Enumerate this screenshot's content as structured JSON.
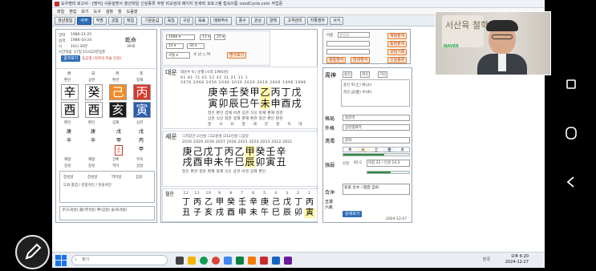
{
  "app": {
    "icon_color": "#c62d2d"
  },
  "window": {
    "title": "도우명리 보고서 - [명식]",
    "title_parts": [
      "사용설명서",
      "출산택일",
      "신살종류",
      "주방 비교검색",
      "페이지 만세력",
      "포토그램 접속이름",
      "coodCycle.com",
      "작업중"
    ]
  },
  "menu": [
    "파일",
    "편집",
    "보기",
    "도구",
    "설정",
    "창",
    "도움말"
  ],
  "toolbar": [
    "생년월일",
    "사주",
    "작명",
    "궁합",
    "택일",
    "기문둔갑",
    "육임",
    "구성",
    "육효",
    "매화역수",
    "풍수",
    "관상",
    "양택",
    "고객관리",
    "카톡명부",
    "서식"
  ],
  "left": {
    "birth_label": "양력",
    "birth_date": "1986-11-25",
    "lunar_label": "음력",
    "lunar_date": "1986-10-24",
    "time_label": "시",
    "time": "10시 30분",
    "apply_label": "시간적용",
    "apply_val": "17일 15시22분입춘",
    "gender": "乾命",
    "age": "39세",
    "btn_blue": "결과보기",
    "note": "동공생 (귀하의 미술 신살)",
    "header": [
      "時",
      "日",
      "月",
      "年"
    ],
    "ten_gods_top": [
      "편인",
      "상관",
      "편관",
      "정재"
    ],
    "stems": [
      "辛",
      "癸",
      "己",
      "丙"
    ],
    "branches": [
      "酉",
      "酉",
      "亥",
      "寅"
    ],
    "ten_gods_bot": [
      "편인",
      "편인",
      "겁재",
      "상관"
    ],
    "hidden": [
      [
        "庚",
        "辛"
      ],
      [
        "庚",
        "辛"
      ],
      [
        "戊",
        "甲",
        "壬"
      ],
      [
        "戊",
        "丙",
        "甲"
      ]
    ],
    "row_a": [
      "제왕",
      "제왕",
      "건록",
      "목욕"
    ],
    "row_b": [
      "장성",
      "장성",
      "역마",
      "겁살"
    ],
    "row_c": [
      "장성살",
      "장성살",
      "역마살",
      "겁살"
    ],
    "notes1": "도화 홍염 / 문창귀인 / 천을귀인",
    "notes2": "子(도화살) 寅(역마살) 申(겁살) 술(화개살)"
  },
  "daeun": {
    "title": "대운",
    "summary": "대운수 9 / 순행 (시작 1995년)",
    "ages": [
      "91",
      "81",
      "71",
      "61",
      "51",
      "41",
      "31",
      "21",
      "11",
      "1"
    ],
    "years": [
      "2076",
      "2066",
      "2056",
      "2046",
      "2036",
      "2026",
      "2016",
      "2006",
      "1996",
      "1986"
    ],
    "stems": [
      "庚",
      "辛",
      "壬",
      "癸",
      "甲",
      "乙",
      "丙",
      "丁",
      "戊"
    ],
    "branches": [
      "寅",
      "卯",
      "辰",
      "巳",
      "午",
      "未",
      "申",
      "酉",
      "戌"
    ],
    "gods_top": "정인 편인 겁재 비견 상관 식신 정재 편재 정관",
    "gods_bot": "상관 식신 정관 정재 편재 편관 정인 편인 편관",
    "stage": "병 사 묘 절 태 양 생 욕 대"
  },
  "sewoon": {
    "title": "세운",
    "options": [
      "지장간",
      "신살",
      "12운성",
      "12신살",
      "공망"
    ],
    "years": [
      "2030",
      "2029",
      "2028",
      "2027",
      "2026",
      "2025",
      "2024",
      "2023",
      "2022",
      "2021"
    ],
    "stems": [
      "庚",
      "己",
      "戊",
      "丁",
      "丙",
      "乙",
      "甲",
      "癸",
      "壬",
      "辛"
    ],
    "branches": [
      "戌",
      "酉",
      "申",
      "未",
      "午",
      "巳",
      "辰",
      "卯",
      "寅",
      "丑"
    ],
    "gods": "정인 편관 정관 편재 정재 식신 상관 비견 겁재 편인",
    "highlight": "甲辰"
  },
  "wolun": {
    "title": "월운",
    "months": [
      "12",
      "11",
      "10",
      "9",
      "8",
      "7",
      "6",
      "5",
      "4",
      "3",
      "2",
      "1"
    ],
    "stems": [
      "丁",
      "丙",
      "乙",
      "甲",
      "癸",
      "壬",
      "辛",
      "庚",
      "己",
      "戊",
      "丁",
      "丙"
    ],
    "branches": [
      "丑",
      "子",
      "亥",
      "戌",
      "酉",
      "申",
      "未",
      "午",
      "巳",
      "辰",
      "卯",
      "寅"
    ]
  },
  "right": {
    "ju_label": "周神",
    "ju_items": [
      "용신",
      "희신",
      "기신"
    ],
    "ju_text1": "용신 토(土) 화(火)",
    "ju_text2": "희신 금(金) 수(水)",
    "geok_label": "格局",
    "geok_val": "정관격",
    "oe_label": "外格",
    "oe_val": "상관생재격",
    "ang_label": "淸濁",
    "ang_val": "중화",
    "five": [
      "木",
      "火",
      "土",
      "金",
      "水"
    ],
    "gang_label": "强弱",
    "gang_val": "신강",
    "gang_pct": "65.5",
    "gang_note": "비겁 22 / 인성 14.3",
    "balance": 0.62,
    "hap_label": "合沖",
    "hap_val": "亥寅 合木 / 酉酉 自刑",
    "date": "2024-12-27",
    "side_btns": [
      "재정분석",
      "통변분석",
      "상담기록",
      "신살종류"
    ],
    "top_orange": [
      "명식보기",
      "기본명식",
      "궁합보기"
    ],
    "top_orange2": [
      "정통명식",
      "현대명식"
    ],
    "top_input_label": "이름",
    "top_input_placeholder": "홍길동"
  },
  "taskbar": {
    "search_placeholder": "찾기",
    "ime": "한국",
    "time": "오후 6:20",
    "date": "2024-12-27"
  },
  "video": {
    "sign_text": "서산육 철학관",
    "naver": "NAVER"
  }
}
